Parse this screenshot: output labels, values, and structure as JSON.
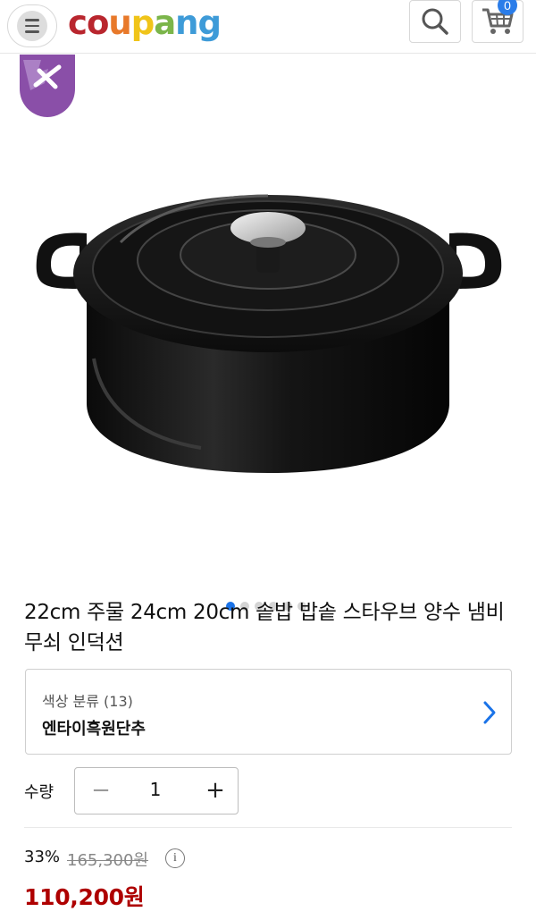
{
  "header": {
    "logo_parts": [
      "c",
      "o",
      "u",
      "p",
      "a",
      "n",
      "g"
    ],
    "cart_count": "0",
    "icons": [
      "menu-icon",
      "search-icon",
      "cart-icon"
    ]
  },
  "gallery": {
    "dot_count": 6,
    "active_index": 0
  },
  "product": {
    "title": "22cm 주물 24cm 20cm 솥밥 밥솥 스타우브 양수 냄비 무쇠 인덕션"
  },
  "option": {
    "label": "색상 분류 (13)",
    "value": "엔타이흑원단추"
  },
  "quantity": {
    "label": "수량",
    "value": "1",
    "minus": "−",
    "plus": "+"
  },
  "price": {
    "discount": "33%",
    "original": "165,300원",
    "sale": "110,200원",
    "info_symbol": "i"
  },
  "colors": {
    "accent_blue": "#1a73e8",
    "sale_red": "#ae0000",
    "badge_purple": "#8a4fa8"
  }
}
